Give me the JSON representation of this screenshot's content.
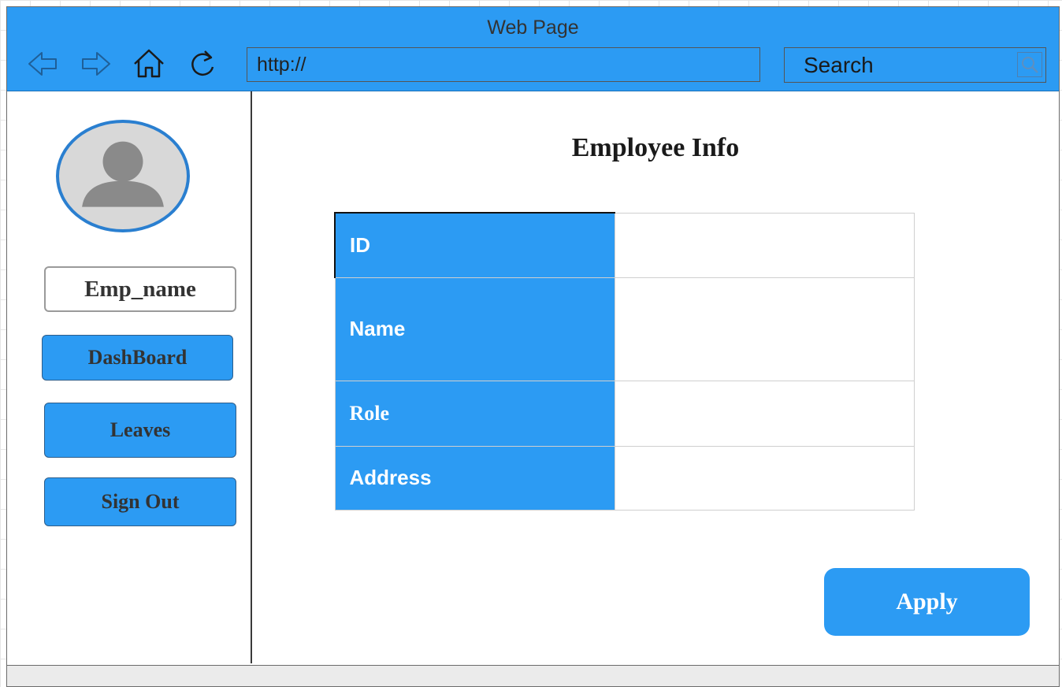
{
  "browser": {
    "title": "Web Page",
    "url": "http://",
    "search_placeholder": "Search"
  },
  "sidebar": {
    "user_name": "Emp_name",
    "buttons": {
      "dashboard": "DashBoard",
      "leaves": "Leaves",
      "sign_out": "Sign Out"
    }
  },
  "main": {
    "title": "Employee Info",
    "fields": [
      {
        "label": "ID",
        "value": ""
      },
      {
        "label": "Name",
        "value": ""
      },
      {
        "label": "Role",
        "value": ""
      },
      {
        "label": "Address",
        "value": ""
      }
    ],
    "apply_label": "Apply"
  },
  "colors": {
    "accent": "#2c9bf3",
    "avatar_ring": "#2a7fd0",
    "avatar_fill": "#d8d8d8",
    "avatar_figure": "#8a8a8a"
  },
  "icons": [
    "back-arrow-icon",
    "forward-arrow-icon",
    "home-icon",
    "refresh-icon",
    "search-icon",
    "user-avatar-icon"
  ]
}
